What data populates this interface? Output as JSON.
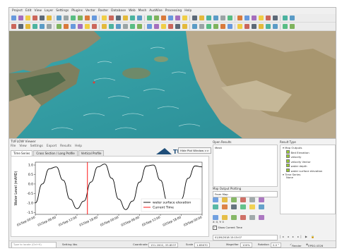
{
  "menu": [
    "Project",
    "Edit",
    "View",
    "Layer",
    "Settings",
    "Plugins",
    "Vector",
    "Raster",
    "Database",
    "Web",
    "Mesh",
    "AusWise",
    "Processing",
    "Help"
  ],
  "viewer": {
    "title": "TUFLOW Viewer",
    "menu": [
      "File",
      "View",
      "Settings",
      "Export",
      "Results",
      "Help"
    ],
    "tabs": [
      "Time Series",
      "Cross Section / Long Profile",
      "Vertical Profile"
    ],
    "logo_text": "TUFLOW",
    "hide_button": "Hide Plot Window >>"
  },
  "open_results": {
    "title": "Open Results",
    "item": "Mesh"
  },
  "map_output": {
    "title": "Map Output Plotting",
    "selector": "From Map"
  },
  "result_type": {
    "title": "Result Type",
    "items": [
      "Map Outputs",
      "Bed Elevation",
      "velocity",
      "velocity Vector",
      "water depth",
      "water surface elevation",
      "Time Series",
      "None"
    ]
  },
  "chart_data": {
    "type": "line",
    "ylabel": "Water Level (mAHD)",
    "ylim": [
      -1.5,
      1.0
    ],
    "yticks": [
      "1.0",
      "0.5",
      "0.0",
      "-0.5",
      "-1.0",
      "-1.5"
    ],
    "xticks": [
      "01/Sep 00:00",
      "01/Sep 06:00",
      "01/Sep 12:00",
      "01/Sep 18:00",
      "02/Sep 00:00",
      "02/Sep 06:00",
      "02/Sep 12:00",
      "02/Sep 18:00",
      "03/Sep 00:00"
    ],
    "series": [
      {
        "name": "water surface elevation",
        "color": "#000000",
        "x": [
          0,
          2,
          4,
          6,
          8,
          10,
          12,
          14,
          16,
          18,
          20,
          22,
          24,
          26,
          28,
          30,
          32,
          34,
          36,
          38,
          40,
          42,
          44,
          46,
          48
        ],
        "values": [
          -1.0,
          0.0,
          0.8,
          0.9,
          0.2,
          -0.8,
          -1.3,
          -0.9,
          0.1,
          0.9,
          1.05,
          0.3,
          -0.8,
          -1.35,
          -0.9,
          0.1,
          0.95,
          1.0,
          0.2,
          -0.9,
          -1.35,
          -0.8,
          0.3,
          0.95,
          0.9
        ]
      }
    ],
    "current_time": {
      "name": "Current Time",
      "x": 15.0,
      "color": "#ff0000"
    }
  },
  "bottom": {
    "time_field": "01/09/2018 15:15:07",
    "show_current_time": "Show Current Time",
    "xy_label": "X: 0, Y: 0"
  },
  "status": {
    "search_placeholder": "Type to locate (Ctrl+K)",
    "message": "Setting libs",
    "coordinate_label": "Coordinate",
    "coordinate": "151.2002,-33.8537",
    "scale_label": "Scale",
    "scale": "1:65670",
    "magnifier_label": "Magnifier",
    "magnifier": "100%",
    "rotation_label": "Rotation",
    "rotation": "0.0 °",
    "render_label": "Render",
    "crs": "EPSG:4326"
  },
  "colors": {
    "water": "#2f9ba2",
    "land": "#b9a98b",
    "mangrove": "#4e6a49"
  }
}
